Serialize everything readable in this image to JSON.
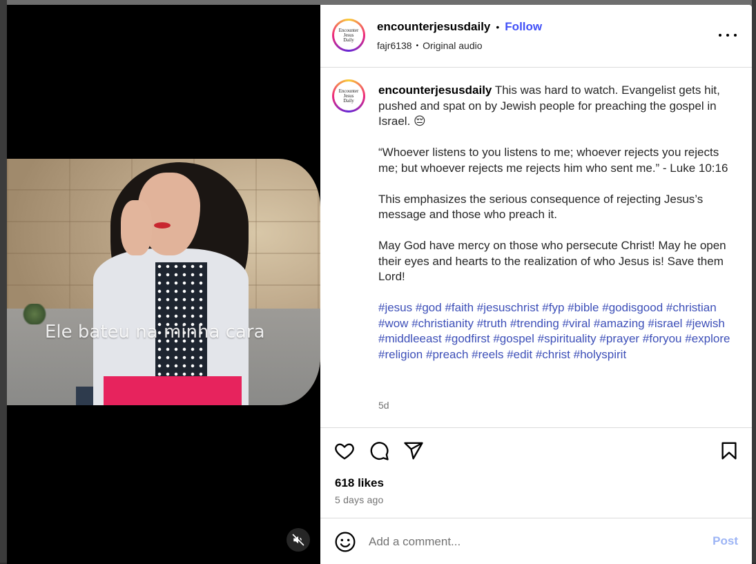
{
  "post": {
    "author": "encounterjesusdaily",
    "follow_label": "Follow",
    "separator": "•",
    "audio_user": "fajr6138",
    "audio_label": "Original audio",
    "avatar_text": [
      "Encounter",
      "Jesus",
      "Daily"
    ]
  },
  "media": {
    "subtitle": "Ele bateu na minha cara",
    "mute_icon": "speaker-muted-icon"
  },
  "caption": {
    "author": "encounterjesusdaily",
    "p1": "This was hard to watch. Evangelist gets hit, pushed and spat on by Jewish people for preaching the gospel in Israel. 😔",
    "p2": "“Whoever listens to you listens to me; whoever rejects you rejects me; but whoever rejects me rejects him who sent me.” - Luke 10:16",
    "p3": "This emphasizes the serious consequence of rejecting Jesus’s message and those who preach it.",
    "p4": "May God have mercy on those who persecute Christ! May he open their eyes and hearts to the realization of who Jesus is! Save them Lord!",
    "hashtags": [
      "#jesus",
      "#god",
      "#faith",
      "#jesuschrist",
      "#fyp",
      "#bible",
      "#godisgood",
      "#christian",
      "#wow",
      "#christianity",
      "#truth",
      "#trending",
      "#viral",
      "#amazing",
      "#israel",
      "#jewish",
      "#middleeast",
      "#godfirst",
      "#gospel",
      "#spirituality",
      "#prayer",
      "#foryou",
      "#explore",
      "#religion",
      "#preach",
      "#reels",
      "#edit",
      "#christ",
      "#holyspirit"
    ],
    "time_ago": "5d"
  },
  "actions": {
    "icons": [
      "heart-icon",
      "comment-icon",
      "share-icon",
      "bookmark-icon"
    ]
  },
  "stats": {
    "likes": "618 likes",
    "date": "5 days ago"
  },
  "comment": {
    "placeholder": "Add a comment...",
    "post_label": "Post"
  },
  "colors": {
    "follow": "#4150f7",
    "hashtag": "#3d4fb8",
    "post_disabled": "#9cb4f5",
    "muted_text": "#737373"
  }
}
